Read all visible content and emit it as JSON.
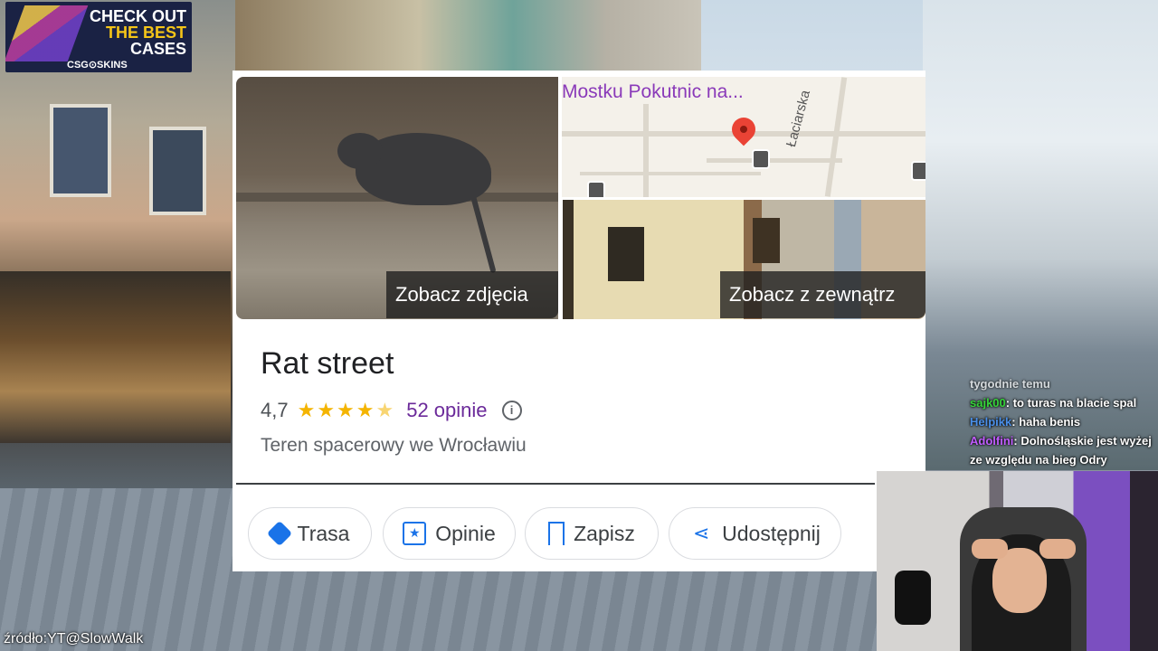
{
  "ad": {
    "line1": "CHECK OUT",
    "line2": "THE BEST",
    "line3": "CASES",
    "brand": "CSG⊙SKINS"
  },
  "place_card": {
    "photos_button": "Zobacz zdjęcia",
    "outside_button": "Zobacz z zewnątrz",
    "map": {
      "poi_label": "Mostku Pokutnic na...",
      "street_label": "Łaciarska"
    },
    "title": "Rat street",
    "rating": "4,7",
    "rating_value": 4.7,
    "reviews_link": "52 opinie",
    "subtitle": "Teren spacerowy we Wrocławiu",
    "actions": [
      {
        "label": "Trasa",
        "icon": "directions-icon"
      },
      {
        "label": "Opinie",
        "icon": "reviews-icon"
      },
      {
        "label": "Zapisz",
        "icon": "bookmark-icon"
      },
      {
        "label": "Udostępnij",
        "icon": "share-icon"
      }
    ]
  },
  "chat": {
    "partial_line": "tygodnie temu",
    "messages": [
      {
        "user": "sajk00",
        "text": ": to turas na blacie spal",
        "color": "#36d43a"
      },
      {
        "user": "Helpikk",
        "text": ": haha benis",
        "color": "#4a8fe8"
      },
      {
        "user": "Adolfini",
        "text": ": Dolnośląskie jest wyżej ze względu na bieg Odry",
        "color": "#c15cff"
      }
    ]
  },
  "source_caption": "źródło:YT@SlowWalk"
}
